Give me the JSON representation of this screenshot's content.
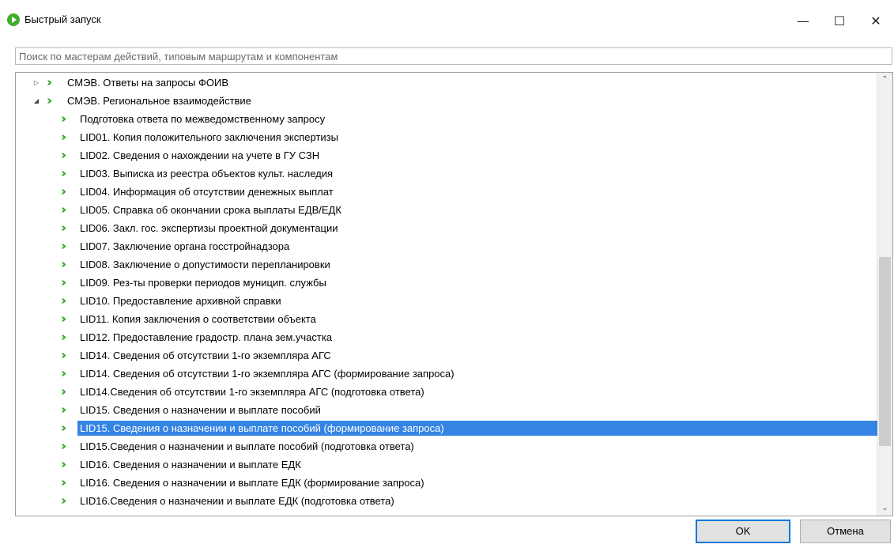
{
  "window": {
    "title": "Быстрый запуск",
    "controls": {
      "minimize": "—",
      "maximize": "☐",
      "close": "✕"
    }
  },
  "search": {
    "placeholder": "Поиск по мастерам действий, типовым маршрутам и компонентам",
    "value": ""
  },
  "tree": {
    "icon": "green-double-chevron-icon",
    "groups": [
      {
        "label": "СМЭВ. Ответы на запросы ФОИВ",
        "expanded": false
      },
      {
        "label": "СМЭВ. Региональное взаимодействие",
        "expanded": true
      }
    ],
    "items": [
      " Подготовка ответа по межведомственному запросу",
      "LID01. Копия положительного заключения экспертизы",
      "LID02. Сведения о нахождении на учете в ГУ СЗН",
      "LID03. Выписка из реестра объектов культ. наследия",
      "LID04. Информация об отсутствии денежных выплат",
      "LID05. Справка об окончании срока выплаты ЕДВ/ЕДК",
      "LID06. Закл. гос. экспертизы проектной документации",
      "LID07. Заключение органа госстройнадзора",
      "LID08. Заключение о допустимости перепланировки",
      "LID09. Рез-ты проверки периодов муницип. службы",
      "LID10. Предоставление архивной справки",
      "LID11. Копия заключения о соответствии объекта",
      "LID12. Предоставление градостр. плана зем.участка",
      "LID14. Сведения об отсутствии 1-го экземпляра АГС",
      "LID14. Сведения об отсутствии 1-го экземпляра АГС (формирование запроса)",
      "LID14.Сведения об отсутствии 1-го экземпляра АГС (подготовка ответа)",
      "LID15. Сведения о назначении и выплате пособий",
      "LID15. Сведения о назначении и выплате пособий (формирование запроса)",
      "LID15.Сведения о назначении и выплате пособий (подготовка ответа)",
      "LID16. Сведения о назначении и выплате ЕДК",
      "LID16. Сведения о назначении и выплате ЕДК (формирование запроса)",
      "LID16.Сведения о назначении и выплате ЕДК (подготовка ответа)"
    ],
    "selected_item": "LID15. Сведения о назначении и выплате пособий (формирование запроса)"
  },
  "buttons": {
    "ok": "OK",
    "cancel": "Отмена"
  },
  "colors": {
    "selection": "#3584e4",
    "icon": "#3aa52e",
    "focus": "#0078d7"
  }
}
